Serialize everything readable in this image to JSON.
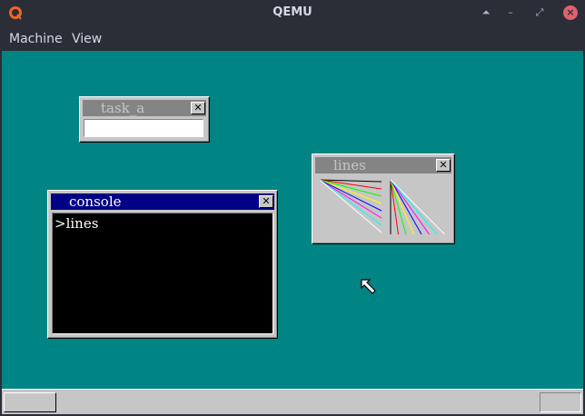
{
  "host": {
    "title": "QEMU",
    "menu": [
      "Machine",
      "View"
    ],
    "icons": [
      "qemu-logo-icon",
      "maximize-icon",
      "minimize-icon",
      "restore-icon",
      "close-icon"
    ]
  },
  "guest": {
    "desktop_color": "#008484",
    "windows": {
      "task_a": {
        "title": "task_a",
        "input_value": ""
      },
      "lines": {
        "title": "lines",
        "line_colors": [
          "#000000",
          "#ff0000",
          "#00ff00",
          "#ffff00",
          "#0000ff",
          "#ff00ff",
          "#00ffff",
          "#ffffff"
        ]
      },
      "console": {
        "title": "console",
        "output": ">lines"
      }
    },
    "close_glyph": "✕",
    "taskbar": {
      "start_label": "",
      "tray_label": ""
    }
  }
}
